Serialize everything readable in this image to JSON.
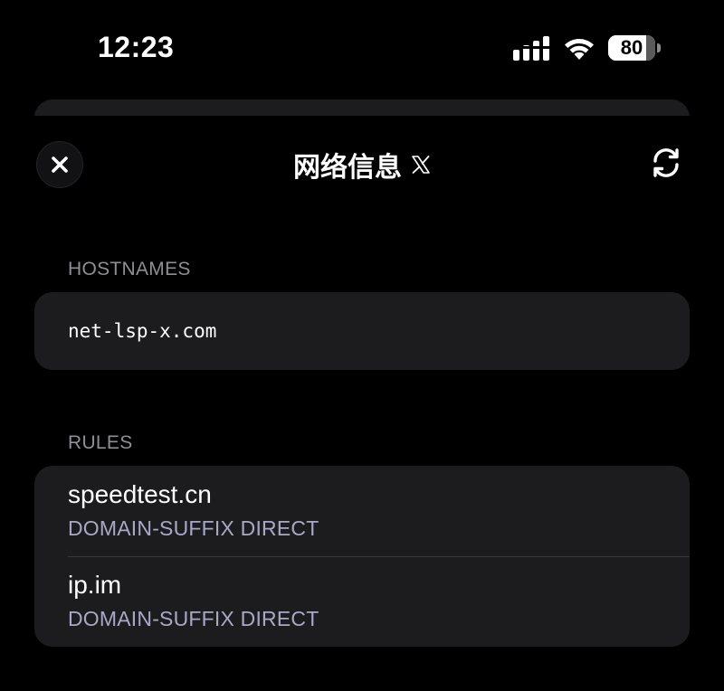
{
  "status_bar": {
    "time": "12:23",
    "battery_percent": 80,
    "battery_label": "80",
    "signal_icon": "cellular-signal-icon",
    "wifi_icon": "wifi-icon"
  },
  "header": {
    "title": "网络信息",
    "title_icon": "x-logo-icon",
    "close_icon": "close-icon",
    "refresh_icon": "refresh-icon"
  },
  "hostnames": {
    "header": "HOSTNAMES",
    "items": [
      "net-lsp-x.com"
    ]
  },
  "rules": {
    "header": "RULES",
    "items": [
      {
        "host": "speedtest.cn",
        "detail": "DOMAIN-SUFFIX DIRECT"
      },
      {
        "host": "ip.im",
        "detail": "DOMAIN-SUFFIX DIRECT"
      }
    ]
  },
  "colors": {
    "background": "#000000",
    "card": "#1c1c1e",
    "section_header": "#8e8e93",
    "rule_detail": "#a8a8c6",
    "separator": "#38383a"
  }
}
